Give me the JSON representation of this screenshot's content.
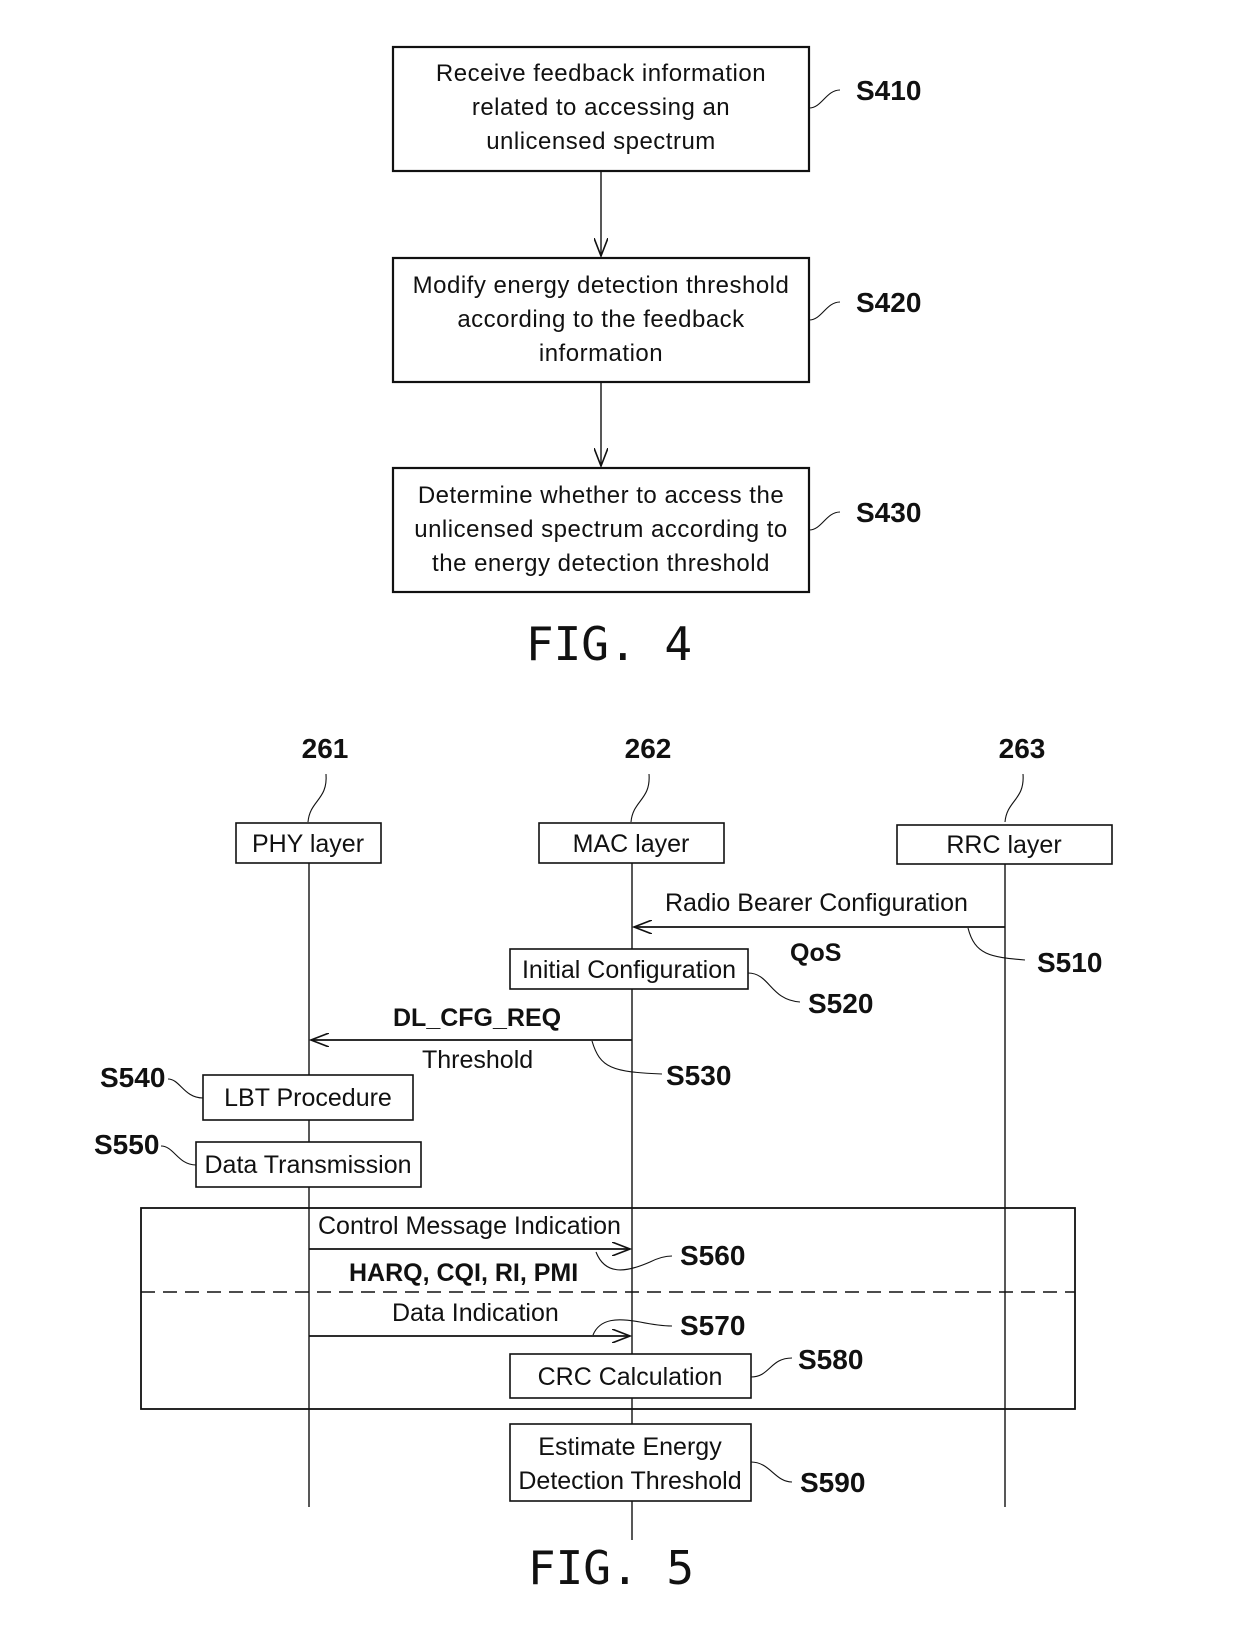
{
  "fig4": {
    "caption": "FIG. 4",
    "steps": [
      {
        "id": "S410",
        "lines": [
          "Receive feedback information",
          "related to accessing an",
          "unlicensed spectrum"
        ]
      },
      {
        "id": "S420",
        "lines": [
          "Modify energy detection threshold",
          "according to the feedback",
          "information"
        ]
      },
      {
        "id": "S430",
        "lines": [
          "Determine whether to access the",
          "unlicensed spectrum according to",
          "the energy detection threshold"
        ]
      }
    ]
  },
  "fig5": {
    "caption": "FIG. 5",
    "lanes": [
      {
        "ref": "261",
        "label": "PHY layer"
      },
      {
        "ref": "262",
        "label": "MAC layer"
      },
      {
        "ref": "263",
        "label": "RRC layer"
      }
    ],
    "messages": {
      "s510": {
        "ref": "S510",
        "label": "Radio Bearer Configuration",
        "sub": "QoS"
      },
      "s530": {
        "ref": "S530",
        "label": "DL_CFG_REQ",
        "sub": "Threshold"
      },
      "s560": {
        "ref": "S560",
        "label": "Control Message Indication",
        "sub": "HARQ, CQI, RI, PMI"
      },
      "s570": {
        "ref": "S570",
        "label": "Data Indication"
      }
    },
    "actions": {
      "s520": {
        "ref": "S520",
        "label": "Initial Configuration"
      },
      "s540": {
        "ref": "S540",
        "label": "LBT Procedure"
      },
      "s550": {
        "ref": "S550",
        "label": "Data Transmission"
      },
      "s580": {
        "ref": "S580",
        "label": "CRC Calculation"
      },
      "s590": {
        "ref": "S590",
        "lines": [
          "Estimate Energy",
          "Detection Threshold"
        ]
      }
    }
  }
}
